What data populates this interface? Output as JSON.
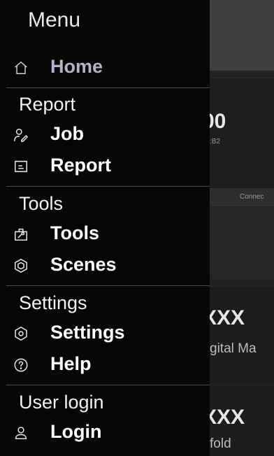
{
  "drawer": {
    "title": "Menu",
    "home": {
      "label": "Home",
      "icon": "home-icon"
    },
    "sections": [
      {
        "header": "Report",
        "items": [
          {
            "label": "Job",
            "icon": "job-icon"
          },
          {
            "label": "Report",
            "icon": "report-icon"
          }
        ]
      },
      {
        "header": "Tools",
        "items": [
          {
            "label": "Tools",
            "icon": "tools-icon"
          },
          {
            "label": "Scenes",
            "icon": "scenes-icon"
          }
        ]
      },
      {
        "header": "Settings",
        "items": [
          {
            "label": "Settings",
            "icon": "settings-icon"
          },
          {
            "label": "Help",
            "icon": "help-icon"
          }
        ]
      },
      {
        "header": "User login",
        "items": [
          {
            "label": "Login",
            "icon": "user-icon"
          }
        ]
      }
    ]
  },
  "background": {
    "card1_value": "00",
    "card1_sub": ":B2",
    "card1_strip": "Connec",
    "card2_value": "XXX",
    "card2_sub": "gital Ma",
    "card3_value": "XXX",
    "card3_sub": "fold"
  },
  "colors": {
    "drawer_bg": "#060606",
    "home_label": "#b7b2c2",
    "divider": "#4a4a4a"
  }
}
